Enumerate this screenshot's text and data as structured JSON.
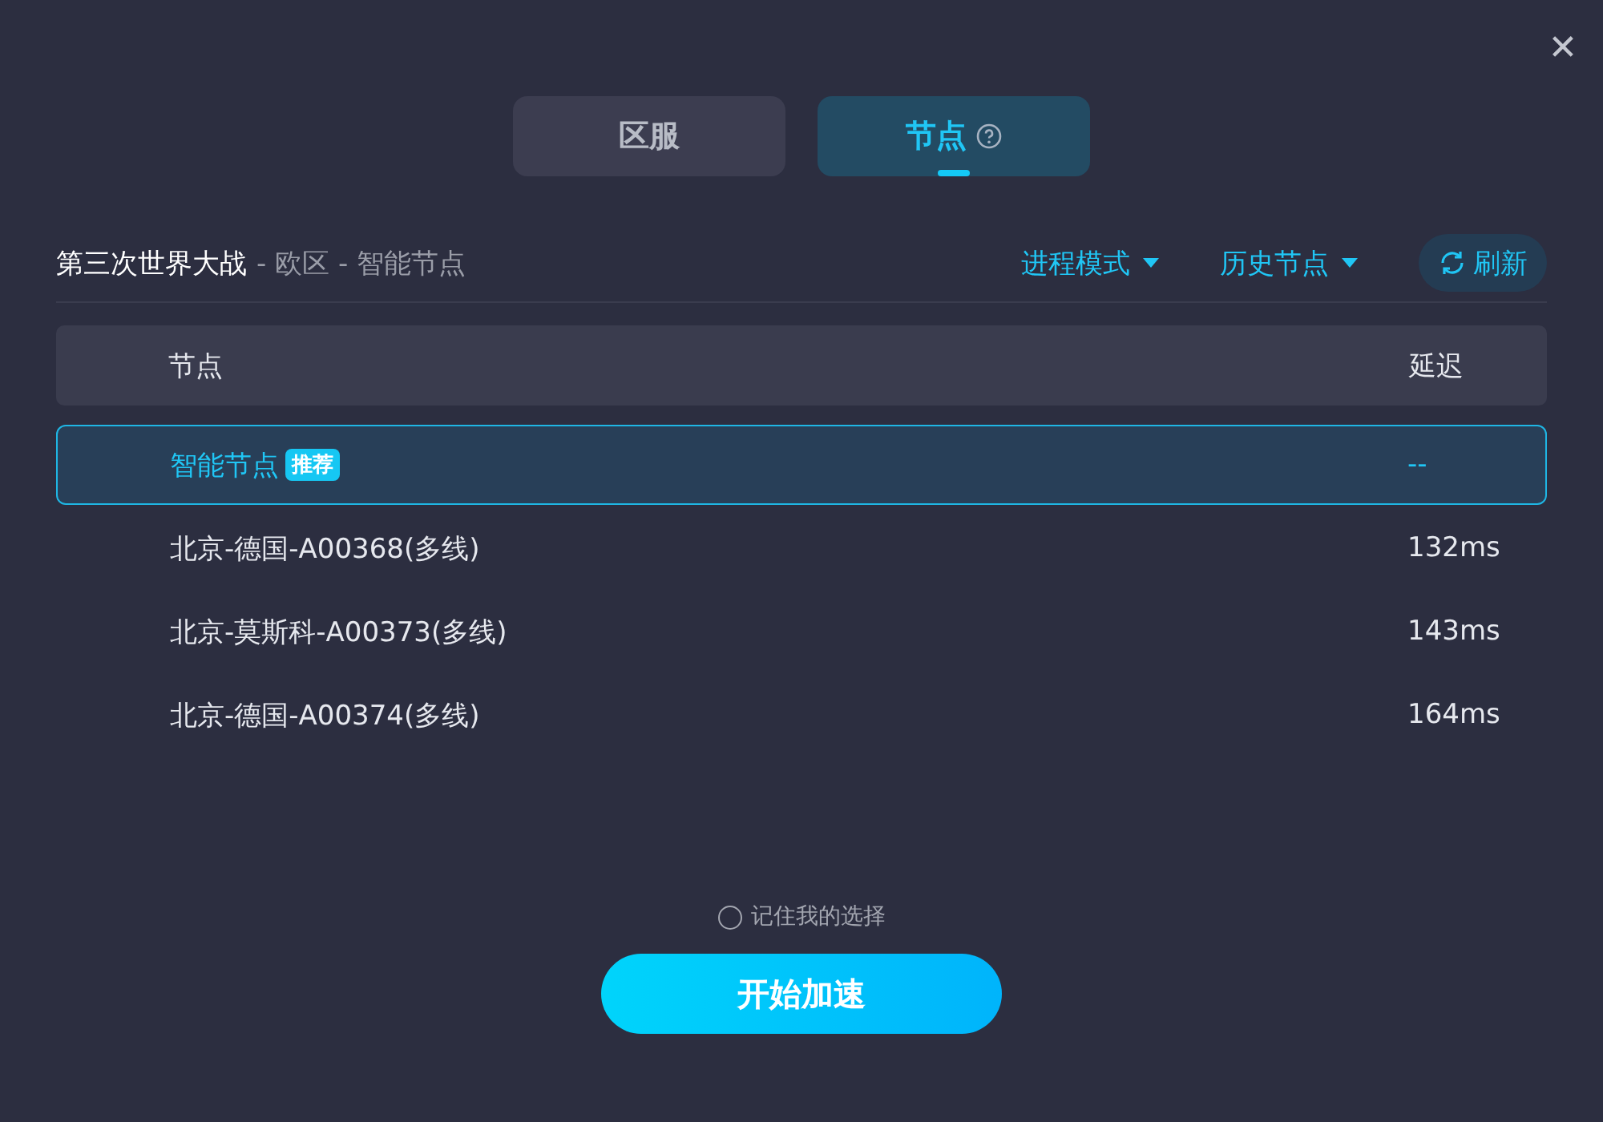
{
  "close": "✕",
  "tabs": [
    {
      "label": "区服",
      "selected": false,
      "help": false
    },
    {
      "label": "节点",
      "selected": true,
      "help": true
    }
  ],
  "breadcrumb": {
    "game": "第三次世界大战",
    "path": "- 欧区 - 智能节点"
  },
  "toolbar": {
    "mode": "进程模式",
    "history": "历史节点",
    "refresh": "刷新"
  },
  "table": {
    "columns": [
      "节点",
      "延迟"
    ],
    "rows": [
      {
        "name": "智能节点",
        "badge": "推荐",
        "latency": "--",
        "selected": true
      },
      {
        "name": "北京-德国-A00368(多线)",
        "latency": "132ms",
        "selected": false
      },
      {
        "name": "北京-莫斯科-A00373(多线)",
        "latency": "143ms",
        "selected": false
      },
      {
        "name": "北京-德国-A00374(多线)",
        "latency": "164ms",
        "selected": false
      }
    ]
  },
  "remember": {
    "label": "记住我的选择",
    "checked": false
  },
  "start_button": "开始加速"
}
